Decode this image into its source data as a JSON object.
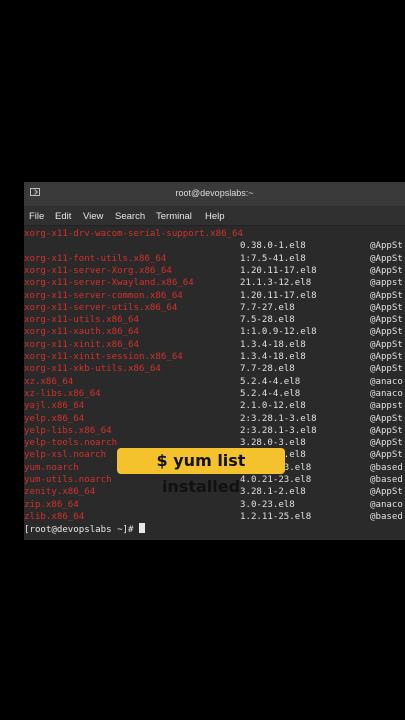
{
  "window": {
    "title": "root@devopslabs:~"
  },
  "menu": [
    "File",
    "Edit",
    "View",
    "Search",
    "Terminal",
    "Help"
  ],
  "rows": [
    {
      "pkg": "xorg-x11-drv-wacom-serial-support.x86_64",
      "ver": "",
      "repo": ""
    },
    {
      "pkg": "",
      "ver": "0.38.0-1.el8",
      "repo": "@AppSt"
    },
    {
      "pkg": "xorg-x11-font-utils.x86_64",
      "ver": "1:7.5-41.el8",
      "repo": "@AppSt"
    },
    {
      "pkg": "xorg-x11-server-Xorg.x86_64",
      "ver": "1.20.11-17.el8",
      "repo": "@AppSt"
    },
    {
      "pkg": "xorg-x11-server-Xwayland.x86_64",
      "ver": "21.1.3-12.el8",
      "repo": "@appst"
    },
    {
      "pkg": "xorg-x11-server-common.x86_64",
      "ver": "1.20.11-17.el8",
      "repo": "@AppSt"
    },
    {
      "pkg": "xorg-x11-server-utils.x86_64",
      "ver": "7.7-27.el8",
      "repo": "@AppSt"
    },
    {
      "pkg": "xorg-x11-utils.x86_64",
      "ver": "7.5-28.el8",
      "repo": "@AppSt"
    },
    {
      "pkg": "xorg-x11-xauth.x86_64",
      "ver": "1:1.0.9-12.el8",
      "repo": "@AppSt"
    },
    {
      "pkg": "xorg-x11-xinit.x86_64",
      "ver": "1.3.4-18.el8",
      "repo": "@AppSt"
    },
    {
      "pkg": "xorg-x11-xinit-session.x86_64",
      "ver": "1.3.4-18.el8",
      "repo": "@AppSt"
    },
    {
      "pkg": "xorg-x11-xkb-utils.x86_64",
      "ver": "7.7-28.el8",
      "repo": "@AppSt"
    },
    {
      "pkg": "xz.x86_64",
      "ver": "5.2.4-4.el8",
      "repo": "@anaco"
    },
    {
      "pkg": "xz-libs.x86_64",
      "ver": "5.2.4-4.el8",
      "repo": "@anaco"
    },
    {
      "pkg": "yajl.x86_64",
      "ver": "2.1.0-12.el8",
      "repo": "@appst"
    },
    {
      "pkg": "yelp.x86_64",
      "ver": "2:3.28.1-3.el8",
      "repo": "@AppSt"
    },
    {
      "pkg": "yelp-libs.x86_64",
      "ver": "2:3.28.1-3.el8",
      "repo": "@AppSt"
    },
    {
      "pkg": "yelp-tools.noarch",
      "ver": "3.28.0-3.el8",
      "repo": "@AppSt"
    },
    {
      "pkg": "yelp-xsl.noarch",
      "ver": "3.28.0-2.el8",
      "repo": "@AppSt"
    },
    {
      "pkg": "yum.noarch",
      "ver": "4.0.21-23.el8",
      "repo": "@based"
    },
    {
      "pkg": "yum-utils.noarch",
      "ver": "4.0.21-23.el8",
      "repo": "@based"
    },
    {
      "pkg": "zenity.x86_64",
      "ver": "3.28.1-2.el8",
      "repo": "@AppSt"
    },
    {
      "pkg": "zip.x86_64",
      "ver": "3.0-23.el8",
      "repo": "@anaco"
    },
    {
      "pkg": "zlib.x86_64",
      "ver": "1.2.11-25.el8",
      "repo": "@based"
    }
  ],
  "prompt": "[root@devopslabs ~]# ",
  "caption": "$ yum list installed"
}
